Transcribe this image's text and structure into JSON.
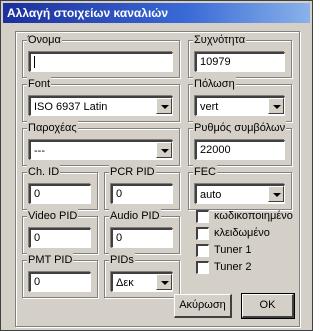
{
  "window": {
    "title": "Αλλαγή στοιχείων καναλιών"
  },
  "fields": {
    "name": {
      "label": "Όνομα",
      "value": ""
    },
    "frequency": {
      "label": "Συχνότητα",
      "value": "10979"
    },
    "font": {
      "label": "Font",
      "value": "ISO 6937 Latin"
    },
    "polarization": {
      "label": "Πόλωση",
      "value": "vert"
    },
    "provider": {
      "label": "Παροχέας",
      "value": "---"
    },
    "symbol_rate": {
      "label": "Ρυθμός συμβόλων",
      "value": "22000"
    },
    "ch_id": {
      "label": "Ch. ID",
      "value": "0"
    },
    "pcr_pid": {
      "label": "PCR PID",
      "value": "0"
    },
    "fec": {
      "label": "FEC",
      "value": "auto"
    },
    "video_pid": {
      "label": "Video PID",
      "value": "0"
    },
    "audio_pid": {
      "label": "Audio PID",
      "value": "0"
    },
    "pmt_pid": {
      "label": "PMT PID",
      "value": "0"
    },
    "pids": {
      "label": "PIDs",
      "value": "Δεκ"
    }
  },
  "checkboxes": [
    {
      "label": "κωδικοποιημένο",
      "checked": false
    },
    {
      "label": "κλειδωμένο",
      "checked": false
    },
    {
      "label": "Tuner 1",
      "checked": false
    },
    {
      "label": "Tuner 2",
      "checked": false
    }
  ],
  "buttons": {
    "cancel": "Ακύρωση",
    "ok": "OK"
  },
  "colors": {
    "face": "#d4d0c8",
    "title_start": "#1c2f9c",
    "title_end": "#8ab2ea"
  }
}
